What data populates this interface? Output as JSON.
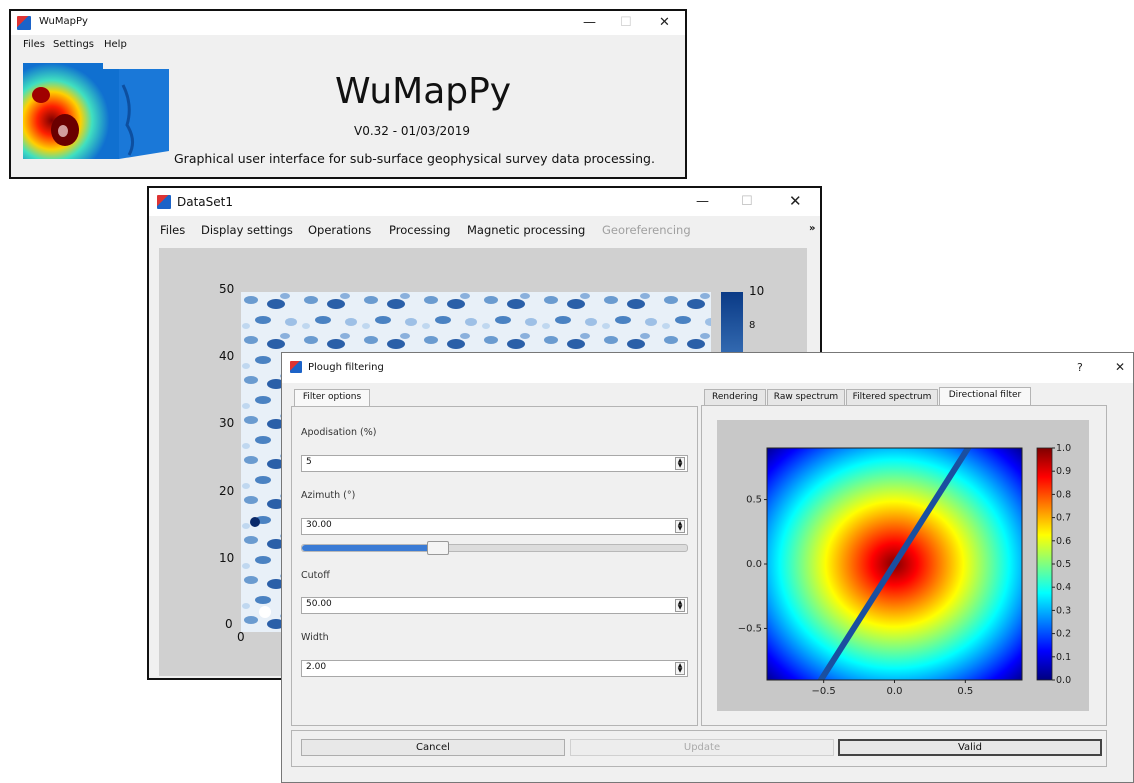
{
  "main_window": {
    "title": "WuMapPy",
    "menu": [
      "Files",
      "Settings",
      "Help"
    ],
    "app_name": "WuMapPy",
    "version": "V0.32 - 01/03/2019",
    "description": "Graphical user interface for sub-surface geophysical survey data processing."
  },
  "dataset_window": {
    "title": "DataSet1",
    "menu": [
      "Files",
      "Display settings",
      "Operations",
      "Processing",
      "Magnetic processing",
      "Georeferencing"
    ],
    "overflow": "»",
    "y_ticks": [
      "50",
      "40",
      "30",
      "20",
      "10",
      "0"
    ],
    "x_ticks": [
      "0"
    ],
    "colorbar_ticks": [
      "10",
      "8"
    ]
  },
  "dialog": {
    "title": "Plough filtering",
    "help": "?",
    "close": "✕",
    "left_tab": "Filter options",
    "fields": [
      {
        "label": "Apodisation (%)",
        "value": "5"
      },
      {
        "label": "Azimuth (°)",
        "value": "30.00"
      },
      {
        "label": "Cutoff",
        "value": "50.00"
      },
      {
        "label": "Width",
        "value": "2.00"
      }
    ],
    "azimuth_slider_fraction": 0.35,
    "right_tabs": [
      "Rendering",
      "Raw spectrum",
      "Filtered spectrum",
      "Directional filter"
    ],
    "active_right_tab": 3,
    "buttons": {
      "cancel": "Cancel",
      "update": "Update",
      "valid": "Valid"
    }
  },
  "window_controls": {
    "minimize": "—",
    "maximize": "☐",
    "close": "✕"
  },
  "chart_data": {
    "type": "heatmap",
    "title": "",
    "x_ticks": [
      "−0.5",
      "0.0",
      "0.5"
    ],
    "y_ticks": [
      "0.5",
      "0.0",
      "−0.5"
    ],
    "xlim": [
      -0.9,
      0.9
    ],
    "ylim": [
      -0.9,
      0.9
    ],
    "colorbar_ticks": [
      "1.0",
      "0.9",
      "0.8",
      "0.7",
      "0.6",
      "0.5",
      "0.4",
      "0.3",
      "0.2",
      "0.1",
      "0.0"
    ],
    "colorbar_range": [
      0.0,
      1.0
    ],
    "colormap": "jet",
    "colormap_colors": [
      "#00007f",
      "#0000ff",
      "#0080ff",
      "#00ffff",
      "#80ff80",
      "#ffff00",
      "#ff8000",
      "#ff0000",
      "#7f0000"
    ],
    "directional_line_azimuth_deg": 30,
    "directional_line_color": "#1a4fa0"
  }
}
